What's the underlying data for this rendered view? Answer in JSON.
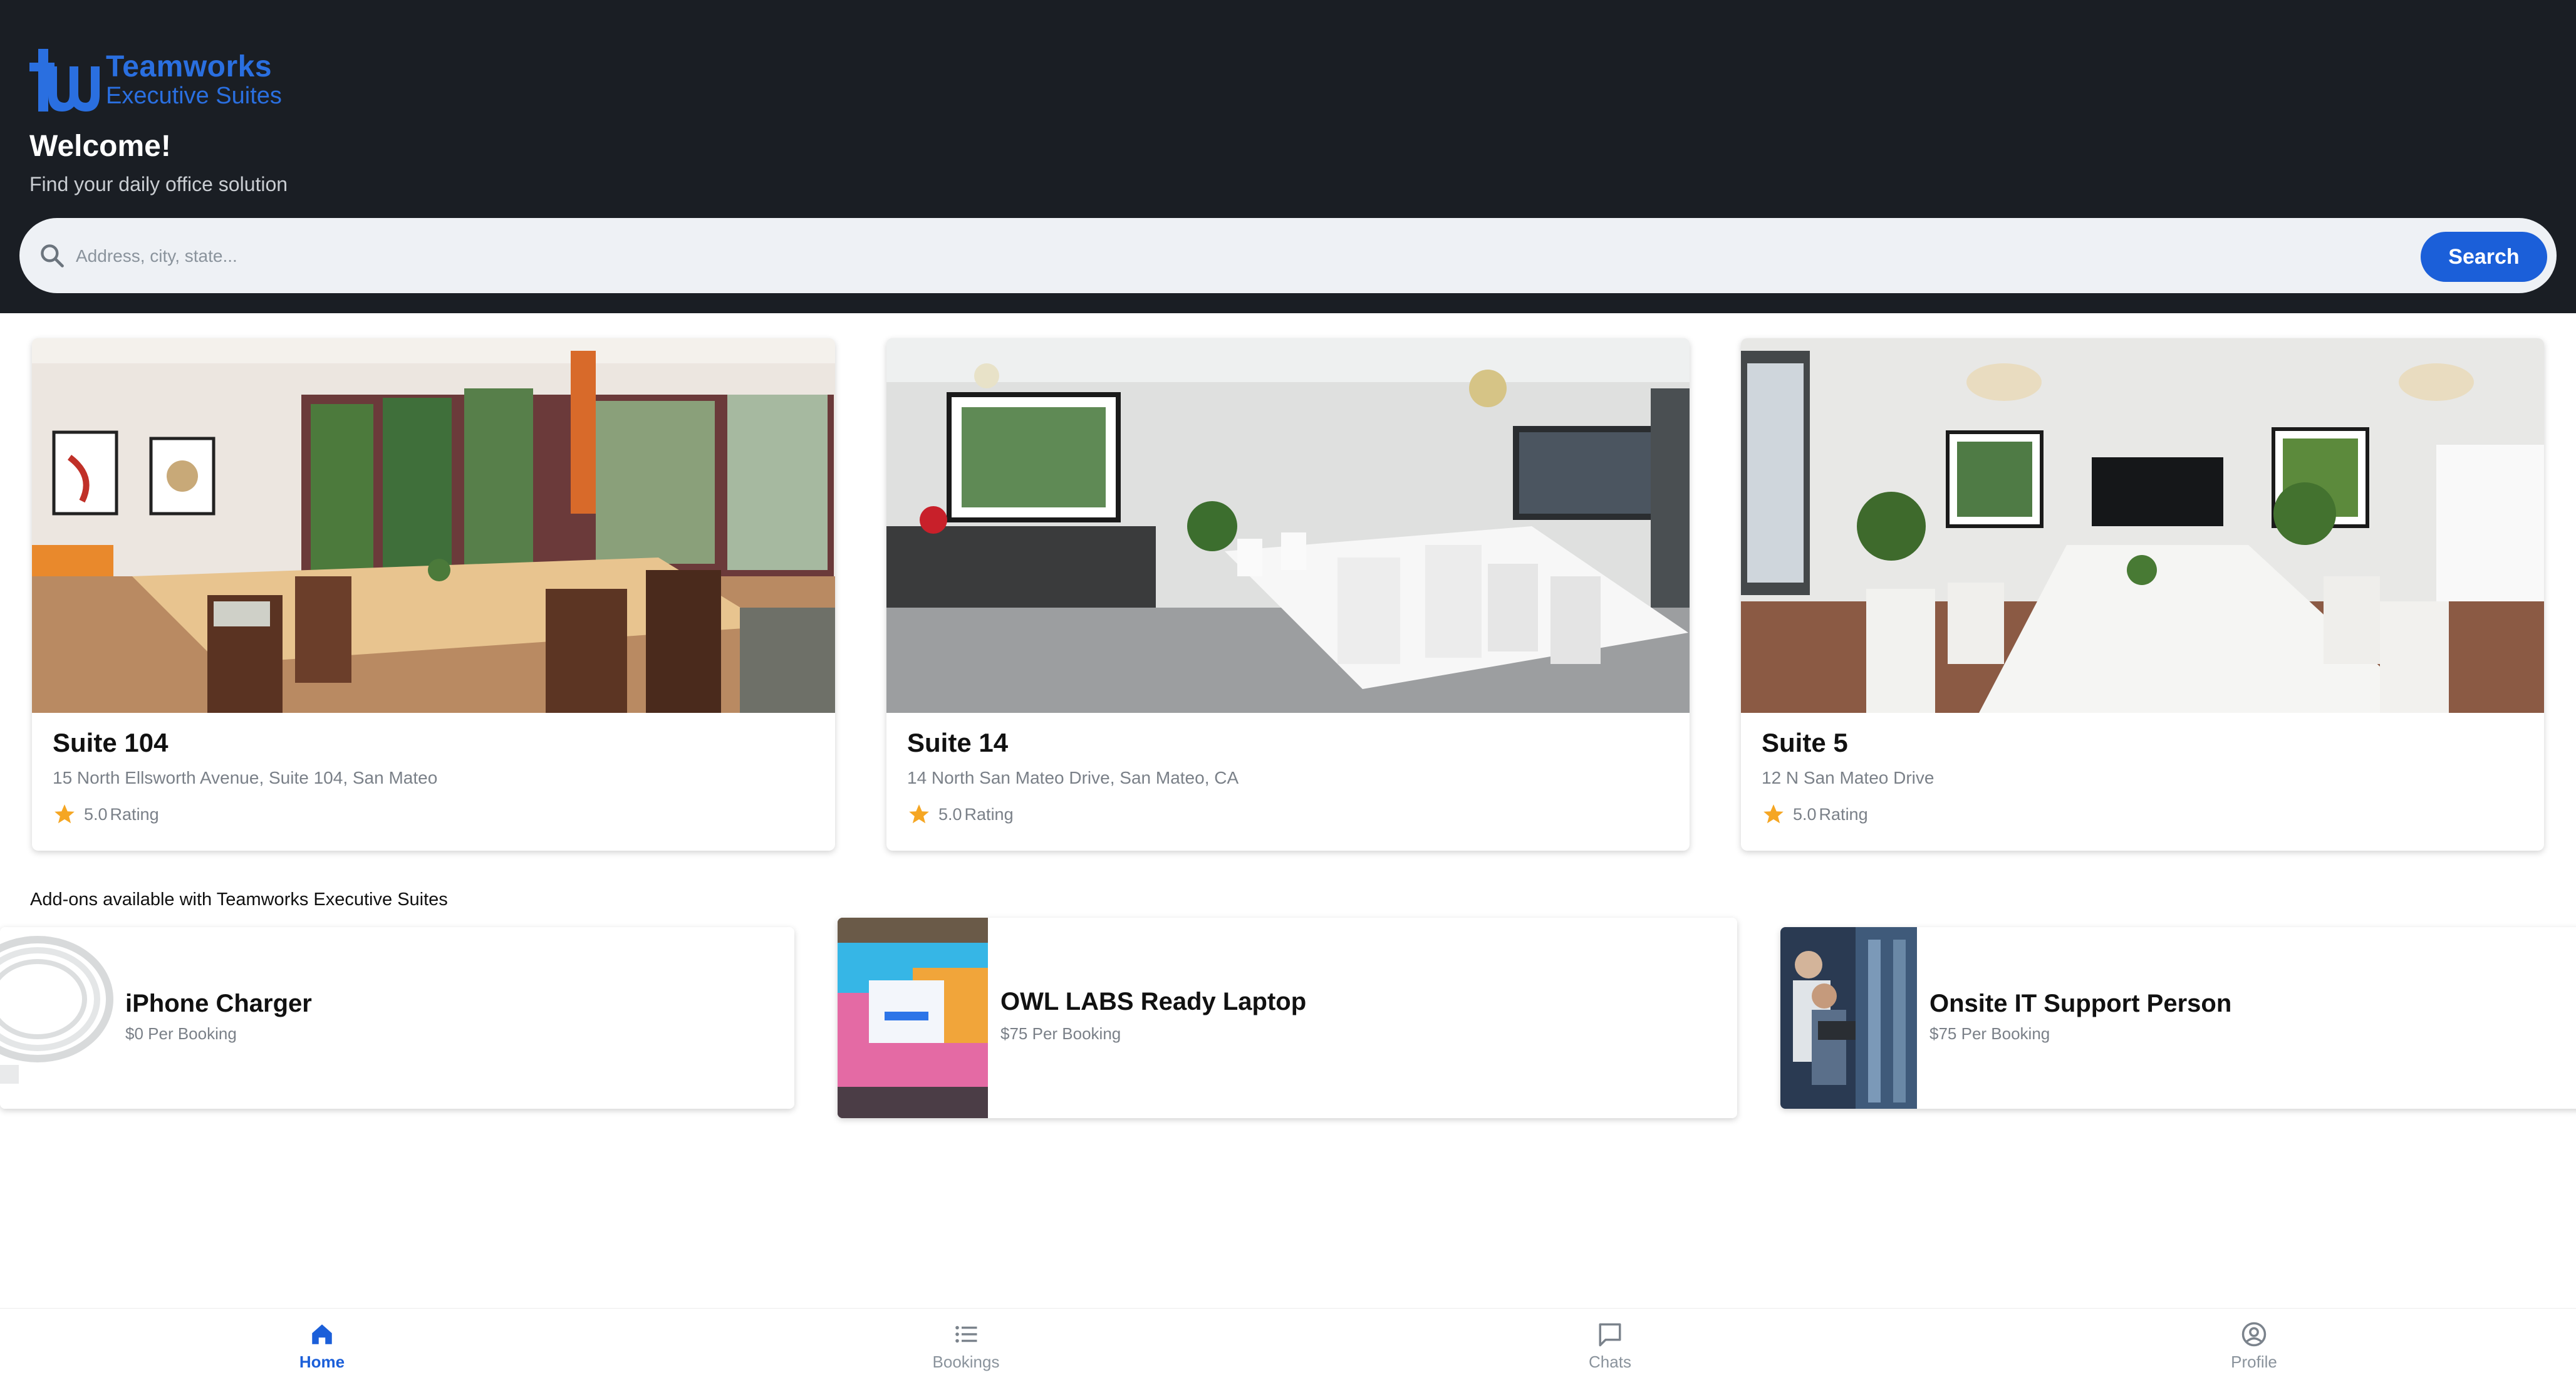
{
  "brand": {
    "name": "Teamworks",
    "subtitle": "Executive Suites",
    "accent": "#2a6fe0"
  },
  "header": {
    "welcome": "Welcome!",
    "tagline": "Find your daily office solution"
  },
  "search": {
    "placeholder": "Address, city, state...",
    "button_label": "Search"
  },
  "suites": [
    {
      "title": "Suite 104",
      "address": "15 North Ellsworth Avenue, Suite 104,  San Mateo",
      "rating": "5.0",
      "rating_label": "Rating"
    },
    {
      "title": "Suite 14",
      "address": "14 North San Mateo Drive, San Mateo, CA",
      "rating": "5.0",
      "rating_label": "Rating"
    },
    {
      "title": "Suite 5",
      "address": "12 N San Mateo Drive",
      "rating": "5.0",
      "rating_label": "Rating"
    }
  ],
  "addons": {
    "heading": "Add-ons available with Teamworks Executive Suites",
    "items": [
      {
        "name": "iPhone Charger",
        "price": "$0 Per Booking"
      },
      {
        "name": "OWL LABS Ready Laptop",
        "price": "$75 Per Booking"
      },
      {
        "name": "Onsite IT Support Person",
        "price": "$75 Per Booking"
      }
    ]
  },
  "nav": {
    "items": [
      {
        "label": "Home",
        "icon": "home-icon",
        "active": true
      },
      {
        "label": "Bookings",
        "icon": "list-icon",
        "active": false
      },
      {
        "label": "Chats",
        "icon": "chat-icon",
        "active": false
      },
      {
        "label": "Profile",
        "icon": "profile-icon",
        "active": false
      }
    ]
  },
  "colors": {
    "header_bg": "#1a1e24",
    "primary": "#1b5fd9",
    "star": "#f5a623",
    "muted_text": "#7a8088"
  }
}
